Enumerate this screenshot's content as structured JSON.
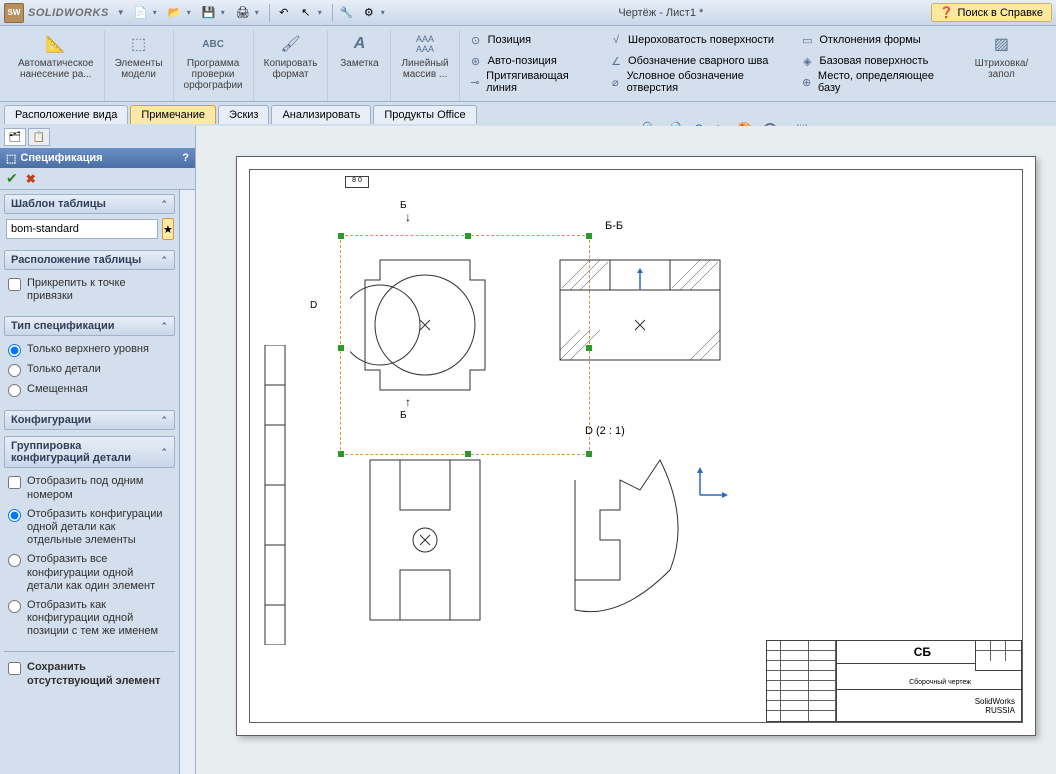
{
  "app": {
    "name": "SOLIDWORKS",
    "doc_title": "Чертёж - Лист1 *",
    "help_search": "Поиск в Справке"
  },
  "ribbon": {
    "auto_dim": "Автоматическое\nнанесение ра...",
    "model_items": "Элементы\nмодели",
    "spell": "Программа\nпроверки\nорфографии",
    "copy_format": "Копировать\nформат",
    "note": "Заметка",
    "linear_pattern": "Линейный\nмассив ...",
    "position": "Позиция",
    "auto_position": "Авто-позиция",
    "magnetic_line": "Притягивающая линия",
    "surface_finish": "Шероховатость поверхности",
    "weld_symbol": "Обозначение сварного шва",
    "hole_callout": "Условное обозначение отверстия",
    "geom_tol": "Отклонения формы",
    "datum": "Базовая поверхность",
    "datum_target": "Место, определяющее базу",
    "hatch": "Штриховка/запол"
  },
  "tabs": {
    "t1": "Расположение вида",
    "t2": "Примечание",
    "t3": "Эскиз",
    "t4": "Анализировать",
    "t5": "Продукты Office"
  },
  "panel": {
    "title": "Спецификация",
    "sec_template": "Шаблон таблицы",
    "template_val": "bom-standard",
    "sec_layout": "Расположение таблицы",
    "attach_anchor": "Прикрепить к точке привязки",
    "sec_type": "Тип спецификации",
    "type_top": "Только верхнего уровня",
    "type_parts": "Только детали",
    "type_indented": "Смещенная",
    "sec_config": "Конфигурации",
    "sec_grouping": "Группировка конфигураций детали",
    "grp_one_num": "Отобразить под одним номером",
    "grp_sep_items": "Отобразить конфигурации одной детали как отдельные элементы",
    "grp_one_item": "Отобразить все конфигурации одной детали как один элемент",
    "grp_same_name": "Отобразить как конфигурации одной позиции с тем же именем",
    "keep_missing": "Сохранить отсутствующий элемент"
  },
  "drawing": {
    "section_bb": "Б-Б",
    "detail_d": "D  (2 : 1)",
    "b_label": "Б",
    "d_label": "D",
    "titleblock_sb": "СБ",
    "titleblock_text": "Сборочный чертеж",
    "titleblock_sw": "SolidWorks\nRUSSIA"
  }
}
